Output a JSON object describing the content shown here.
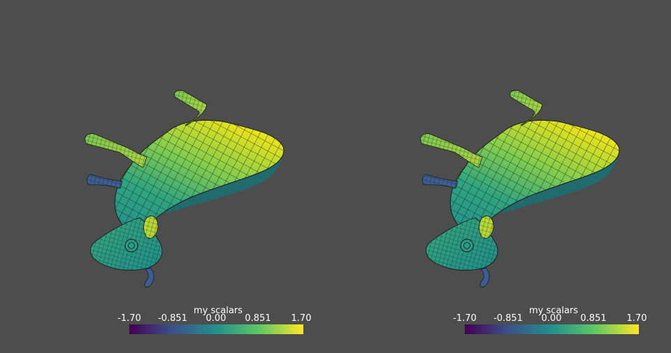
{
  "viewports": [
    {
      "id": "left",
      "scalar_bar": {
        "title": "my scalars",
        "ticks": [
          "-1.70",
          "-0.851",
          "0.00",
          "0.851",
          "1.70"
        ],
        "colormap": [
          "#440154",
          "#3b528b",
          "#21918c",
          "#5ec962",
          "#fde725"
        ]
      }
    },
    {
      "id": "right",
      "scalar_bar": {
        "title": "my scalars",
        "ticks": [
          "-1.70",
          "-0.851",
          "0.00",
          "0.851",
          "1.70"
        ],
        "colormap": [
          "#440154",
          "#3b528b",
          "#21918c",
          "#5ec962",
          "#fde725"
        ]
      }
    }
  ],
  "colors": {
    "background": "#4d4d4d",
    "mesh_edge": "#1a1a1a"
  }
}
